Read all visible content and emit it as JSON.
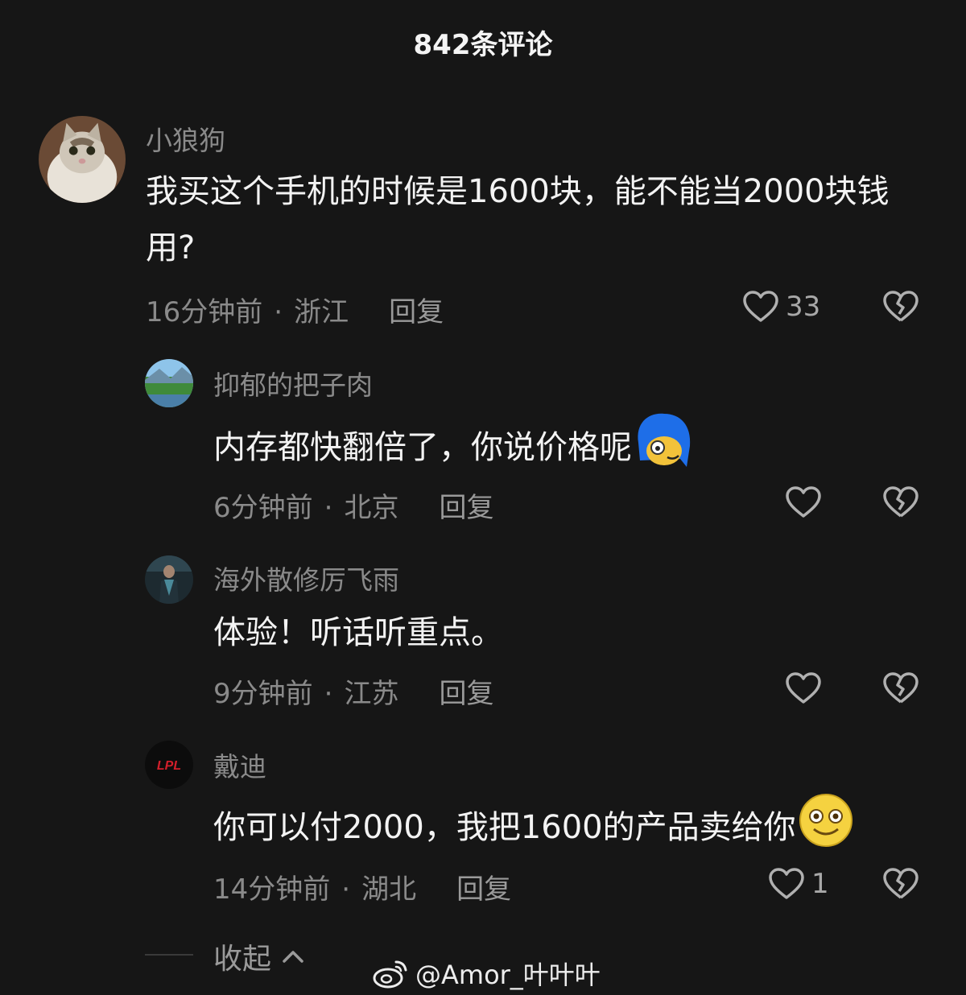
{
  "header": {
    "title": "842条评论"
  },
  "comments": [
    {
      "user": "小狼狗",
      "text": "我买这个手机的时候是1600块，能不能当2000块钱用?",
      "time": "16分钟前",
      "location": "浙江",
      "reply_label": "回复",
      "likes": "33",
      "avatar_icon": "cat-photo-avatar"
    },
    {
      "user": "抑郁的把子肉",
      "text": "内存都快翻倍了，你说价格呢",
      "emoji": "blue-hair-face-emoji",
      "time": "6分钟前",
      "location": "北京",
      "reply_label": "回复",
      "likes": "",
      "avatar_icon": "landscape-avatar"
    },
    {
      "user": "海外散修厉飞雨",
      "text": "体验！听话听重点。",
      "time": "9分钟前",
      "location": "江苏",
      "reply_label": "回复",
      "likes": "",
      "avatar_icon": "figure-avatar"
    },
    {
      "user": "戴迪",
      "text": "你可以付2000，我把1600的产品卖给你",
      "emoji": "smile-face-emoji",
      "time": "14分钟前",
      "location": "湖北",
      "reply_label": "回复",
      "likes": "1",
      "avatar_icon": "lpl-logo-avatar",
      "avatar_logo_text": "LPL"
    }
  ],
  "collapse_label": "收起",
  "watermark": {
    "text": "@Amor_叶叶叶",
    "icon": "weibo-icon"
  },
  "colors": {
    "background": "#161616",
    "text": "#f3f3f3",
    "secondary": "#8a8a8a"
  }
}
